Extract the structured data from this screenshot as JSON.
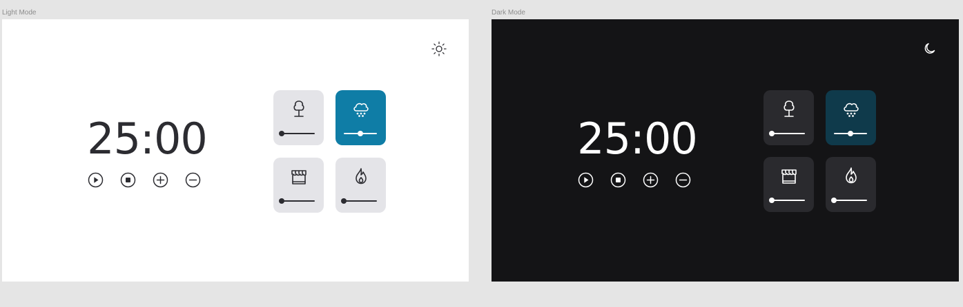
{
  "frames": {
    "light": {
      "label": "Light Mode",
      "theme_icon": "sun-icon"
    },
    "dark": {
      "label": "Dark Mode",
      "theme_icon": "moon-icon"
    }
  },
  "timer": {
    "display": "25:00"
  },
  "controls": [
    "play-icon",
    "stop-icon",
    "plus-icon",
    "minus-icon"
  ],
  "sounds": [
    {
      "id": "forest",
      "icon": "tree-icon",
      "level": 0,
      "active": false
    },
    {
      "id": "rain",
      "icon": "rain-cloud-icon",
      "level": 0.5,
      "active": true
    },
    {
      "id": "cafe",
      "icon": "shop-icon",
      "level": 0,
      "active": false
    },
    {
      "id": "fire",
      "icon": "flame-icon",
      "level": 0,
      "active": false
    }
  ],
  "colors": {
    "accent": "#0f7da6",
    "accent_dark": "#0f3a4b",
    "light_bg": "#ffffff",
    "dark_bg": "#141416",
    "card_light": "#e4e4e8",
    "card_dark": "#2a2a2e",
    "text_light": "#2c2c31",
    "text_dark": "#ffffff"
  }
}
